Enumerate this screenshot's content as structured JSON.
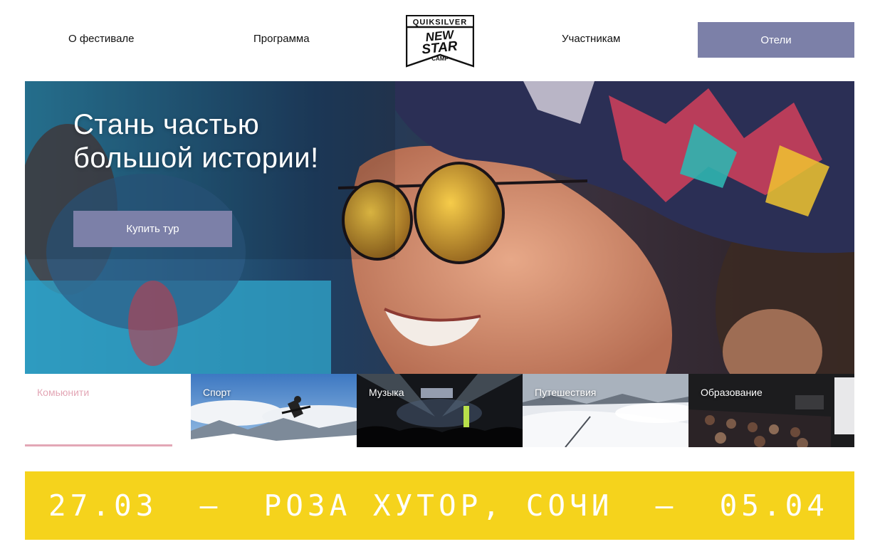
{
  "nav": {
    "about": "О фестивале",
    "program": "Программа",
    "participants": "Участникам",
    "hotels": "Отели"
  },
  "logo": {
    "top_text": "QUIKSILVER",
    "main_line1": "NEW",
    "main_line2": "STAR",
    "bottom_text": "CAMP"
  },
  "hero": {
    "title_line1": "Стань частью",
    "title_line2": "большой истории!",
    "buy_label": "Купить тур"
  },
  "tabs": [
    {
      "label": "Комьюнити",
      "active": true
    },
    {
      "label": "Спорт",
      "active": false
    },
    {
      "label": "Музыка",
      "active": false
    },
    {
      "label": "Путешествия",
      "active": false
    },
    {
      "label": "Образование",
      "active": false
    }
  ],
  "banner": {
    "start_date": "27.03",
    "dash1": "—",
    "location": "РОЗА ХУТОР, СОЧИ",
    "dash2": "—",
    "end_date": "05.04"
  },
  "colors": {
    "accent": "#7c80a8",
    "banner": "#f5d31c",
    "active_tab": "#e3a7b6"
  }
}
